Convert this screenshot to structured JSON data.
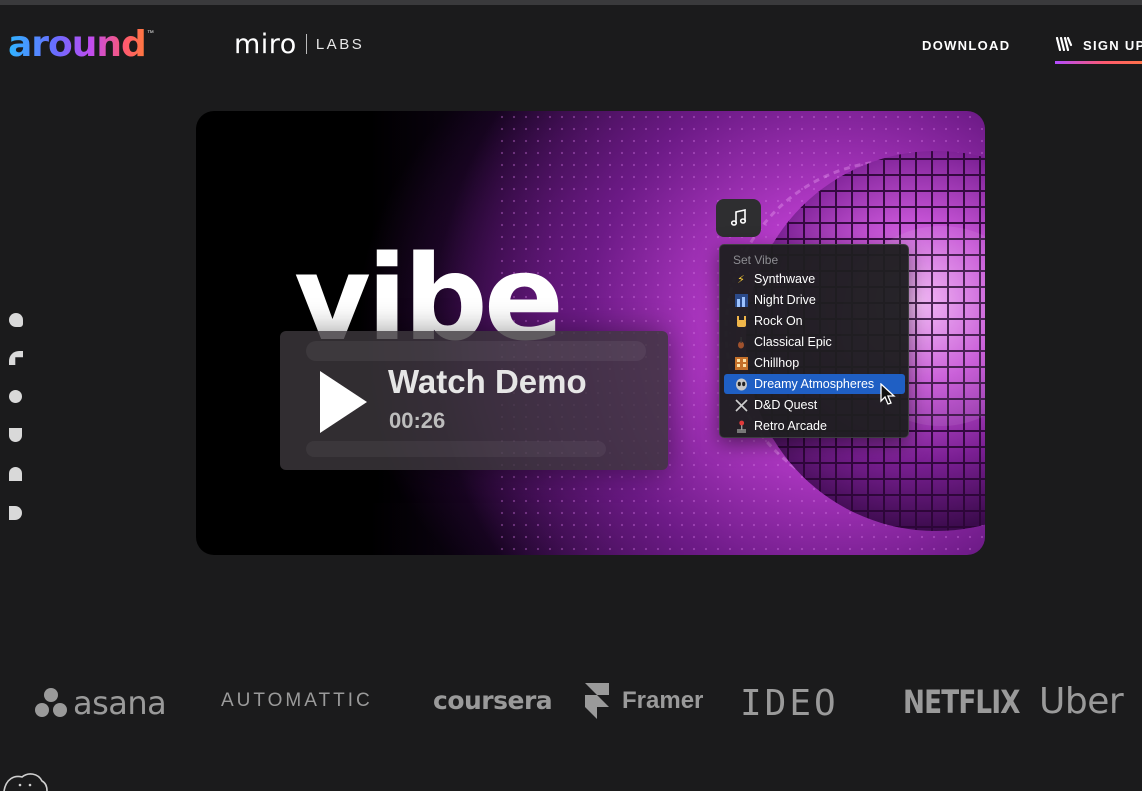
{
  "header": {
    "logo_around": "around",
    "logo_tm": "™",
    "logo_miro": "miro",
    "logo_labs": "LABS",
    "nav_download": "DOWNLOAD",
    "nav_signup": "SIGN UP"
  },
  "hero": {
    "big_text": "vibe",
    "watch_title": "Watch Demo",
    "watch_time": "00:26",
    "menu_header": "Set Vibe",
    "vibe_options": [
      {
        "label": "Synthwave",
        "icon": "lightning-icon"
      },
      {
        "label": "Night Drive",
        "icon": "cityscape-icon"
      },
      {
        "label": "Rock On",
        "icon": "rock-hand-icon"
      },
      {
        "label": "Classical Epic",
        "icon": "violin-icon"
      },
      {
        "label": "Chillhop",
        "icon": "building-icon"
      },
      {
        "label": "Dreamy Atmospheres",
        "icon": "alien-icon",
        "selected": true
      },
      {
        "label": "D&D Quest",
        "icon": "crossed-swords-icon"
      },
      {
        "label": "Retro Arcade",
        "icon": "joystick-icon"
      }
    ]
  },
  "logos": {
    "asana": "asana",
    "automattic": "AUTOMATTIC",
    "coursera": "coursera",
    "framer": "Framer",
    "ideo": "IDEO",
    "netflix": "NETFLIX",
    "uber": "Uber"
  },
  "colors": {
    "background": "#1b1b1c",
    "selected_item": "#1f5fc4",
    "logo_gray": "#9a9a9a"
  }
}
